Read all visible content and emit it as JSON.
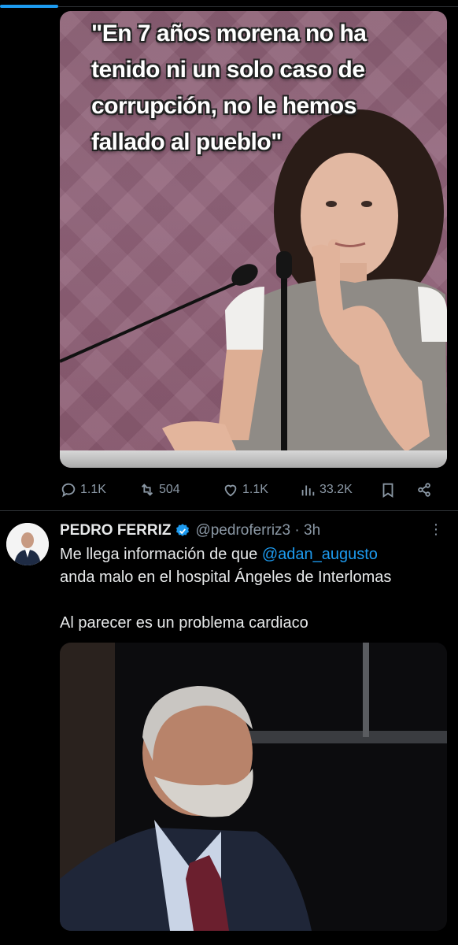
{
  "post1": {
    "media": {
      "quote": "\"En 7 años morena no ha\ntenido ni un solo caso de\ncorrupción, no le hemos\nfallado al pueblo\""
    },
    "actions": {
      "replies": "1.1K",
      "reposts": "504",
      "likes": "1.1K",
      "views": "33.2K"
    }
  },
  "post2": {
    "author": {
      "name": "PEDRO FERRIZ",
      "handle": "@pedroferriz3 · 3h",
      "verified": true
    },
    "text": {
      "line1_pre": "Me llega información de que ",
      "mention": "@adan_augusto",
      "line2": "anda malo en el hospital Ángeles de Interlomas",
      "line3": "Al parecer es un problema cardiaco"
    }
  },
  "colors": {
    "accent": "#1d9bf0",
    "muted": "#8b98a5",
    "text": "#e7e9ea",
    "background": "#000000",
    "divider": "#2f3336"
  },
  "icons": [
    "reply-icon",
    "repost-icon",
    "like-icon",
    "views-icon",
    "bookmark-icon",
    "share-icon",
    "verified-badge-icon",
    "more-icon"
  ]
}
